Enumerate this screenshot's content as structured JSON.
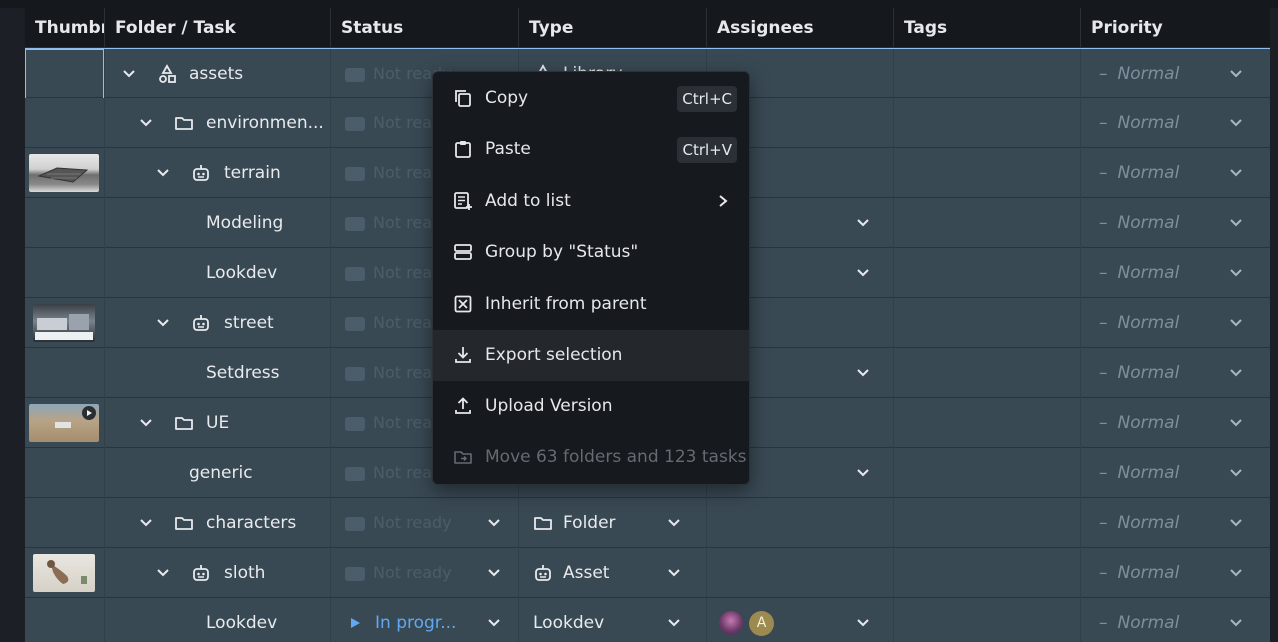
{
  "columns": [
    "Thumbn",
    "Folder / Task",
    "Status",
    "Type",
    "Assignees",
    "Tags",
    "Priority"
  ],
  "rows": [
    {
      "name": "assets",
      "status": "Not ready",
      "type": "Library",
      "priority": "Normal"
    },
    {
      "name": "environmen...",
      "status": "Not ready",
      "type": "",
      "priority": "Normal"
    },
    {
      "name": "terrain",
      "status": "Not ready",
      "type": "",
      "priority": "Normal"
    },
    {
      "name": "Modeling",
      "status": "Not ready",
      "type": "",
      "priority": "Normal"
    },
    {
      "name": "Lookdev",
      "status": "Not ready",
      "type": "",
      "priority": "Normal"
    },
    {
      "name": "street",
      "status": "Not ready",
      "type": "",
      "priority": "Normal"
    },
    {
      "name": "Setdress",
      "status": "Not ready",
      "type": "",
      "priority": "Normal"
    },
    {
      "name": "UE",
      "status": "Not ready",
      "type": "",
      "priority": "Normal"
    },
    {
      "name": "generic",
      "status": "Not ready",
      "type": "",
      "priority": "Normal"
    },
    {
      "name": "characters",
      "status": "Not ready",
      "type": "Folder",
      "priority": "Normal"
    },
    {
      "name": "sloth",
      "status": "Not ready",
      "type": "Asset",
      "priority": "Normal"
    },
    {
      "name": "Lookdev",
      "status": "In progr...",
      "type": "Lookdev",
      "priority": "Normal",
      "assignee_initial": "A"
    }
  ],
  "context_menu": {
    "items": [
      {
        "label": "Copy",
        "shortcut": "Ctrl+C",
        "icon": "copy-icon"
      },
      {
        "label": "Paste",
        "shortcut": "Ctrl+V",
        "icon": "paste-icon"
      },
      {
        "label": "Add to list",
        "icon": "playlist-add-icon",
        "submenu": true
      },
      {
        "label": "Group by \"Status\"",
        "icon": "group-icon"
      },
      {
        "label": "Inherit from parent",
        "icon": "inherit-icon"
      },
      {
        "label": "Export selection",
        "icon": "download-icon",
        "hovered": true
      },
      {
        "label": "Upload Version",
        "icon": "upload-icon"
      },
      {
        "label": "Move 63 folders and 123 tasks",
        "icon": "folder-move-icon",
        "disabled": true
      }
    ]
  },
  "colors": {
    "row_bg": "#394954",
    "header_bg": "#15191d",
    "menu_bg": "#16191d",
    "status_in_progress": "#62a8f0",
    "selection_outline": "#8ec0ef"
  }
}
